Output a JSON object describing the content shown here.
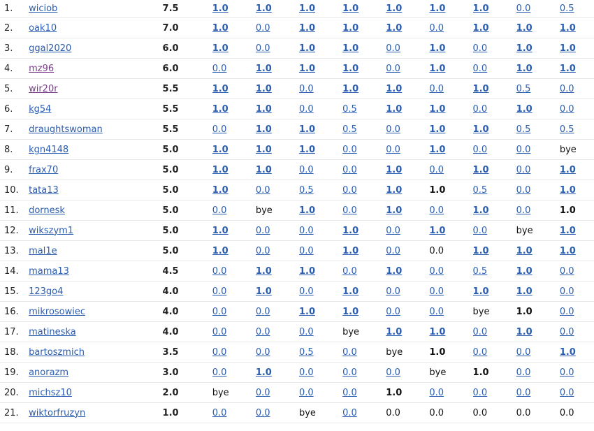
{
  "standings": [
    {
      "rank": "1.",
      "name": "wiciob",
      "points": "7.5",
      "visited": false,
      "results": [
        {
          "v": "1.0",
          "link": true
        },
        {
          "v": "1.0",
          "link": true
        },
        {
          "v": "1.0",
          "link": true
        },
        {
          "v": "1.0",
          "link": true
        },
        {
          "v": "1.0",
          "link": true
        },
        {
          "v": "1.0",
          "link": true
        },
        {
          "v": "1.0",
          "link": true
        },
        {
          "v": "0.0",
          "link": true
        },
        {
          "v": "0.5",
          "link": true
        }
      ]
    },
    {
      "rank": "2.",
      "name": "oak10",
      "points": "7.0",
      "visited": false,
      "results": [
        {
          "v": "1.0",
          "link": true
        },
        {
          "v": "0.0",
          "link": true
        },
        {
          "v": "1.0",
          "link": true
        },
        {
          "v": "1.0",
          "link": true
        },
        {
          "v": "1.0",
          "link": true
        },
        {
          "v": "0.0",
          "link": true
        },
        {
          "v": "1.0",
          "link": true
        },
        {
          "v": "1.0",
          "link": true
        },
        {
          "v": "1.0",
          "link": true
        }
      ]
    },
    {
      "rank": "3.",
      "name": "ggal2020",
      "points": "6.0",
      "visited": false,
      "results": [
        {
          "v": "1.0",
          "link": true
        },
        {
          "v": "0.0",
          "link": true
        },
        {
          "v": "1.0",
          "link": true
        },
        {
          "v": "1.0",
          "link": true
        },
        {
          "v": "0.0",
          "link": true
        },
        {
          "v": "1.0",
          "link": true
        },
        {
          "v": "0.0",
          "link": true
        },
        {
          "v": "1.0",
          "link": true
        },
        {
          "v": "1.0",
          "link": true
        }
      ]
    },
    {
      "rank": "4.",
      "name": "mz96",
      "points": "6.0",
      "visited": true,
      "results": [
        {
          "v": "0.0",
          "link": true
        },
        {
          "v": "1.0",
          "link": true
        },
        {
          "v": "1.0",
          "link": true
        },
        {
          "v": "1.0",
          "link": true
        },
        {
          "v": "0.0",
          "link": true
        },
        {
          "v": "1.0",
          "link": true
        },
        {
          "v": "0.0",
          "link": true
        },
        {
          "v": "1.0",
          "link": true
        },
        {
          "v": "1.0",
          "link": true
        }
      ]
    },
    {
      "rank": "5.",
      "name": "wir20r",
      "points": "5.5",
      "visited": true,
      "results": [
        {
          "v": "1.0",
          "link": true
        },
        {
          "v": "1.0",
          "link": true
        },
        {
          "v": "0.0",
          "link": true
        },
        {
          "v": "1.0",
          "link": true
        },
        {
          "v": "1.0",
          "link": true
        },
        {
          "v": "0.0",
          "link": true
        },
        {
          "v": "1.0",
          "link": true
        },
        {
          "v": "0.5",
          "link": true
        },
        {
          "v": "0.0",
          "link": true
        }
      ]
    },
    {
      "rank": "6.",
      "name": "kg54",
      "points": "5.5",
      "visited": false,
      "results": [
        {
          "v": "1.0",
          "link": true
        },
        {
          "v": "1.0",
          "link": true
        },
        {
          "v": "0.0",
          "link": true
        },
        {
          "v": "0.5",
          "link": true
        },
        {
          "v": "1.0",
          "link": true
        },
        {
          "v": "1.0",
          "link": true
        },
        {
          "v": "0.0",
          "link": true
        },
        {
          "v": "1.0",
          "link": true
        },
        {
          "v": "0.0",
          "link": true
        }
      ]
    },
    {
      "rank": "7.",
      "name": "draughtswoman",
      "points": "5.5",
      "visited": false,
      "results": [
        {
          "v": "0.0",
          "link": true
        },
        {
          "v": "1.0",
          "link": true
        },
        {
          "v": "1.0",
          "link": true
        },
        {
          "v": "0.5",
          "link": true
        },
        {
          "v": "0.0",
          "link": true
        },
        {
          "v": "1.0",
          "link": true
        },
        {
          "v": "1.0",
          "link": true
        },
        {
          "v": "0.5",
          "link": true
        },
        {
          "v": "0.5",
          "link": true
        }
      ]
    },
    {
      "rank": "8.",
      "name": "kgn4148",
      "points": "5.0",
      "visited": false,
      "results": [
        {
          "v": "1.0",
          "link": true
        },
        {
          "v": "1.0",
          "link": true
        },
        {
          "v": "1.0",
          "link": true
        },
        {
          "v": "0.0",
          "link": true
        },
        {
          "v": "0.0",
          "link": true
        },
        {
          "v": "1.0",
          "link": true
        },
        {
          "v": "0.0",
          "link": true
        },
        {
          "v": "0.0",
          "link": true
        },
        {
          "v": "bye",
          "link": false
        }
      ]
    },
    {
      "rank": "9.",
      "name": "frax70",
      "points": "5.0",
      "visited": false,
      "results": [
        {
          "v": "1.0",
          "link": true
        },
        {
          "v": "1.0",
          "link": true
        },
        {
          "v": "0.0",
          "link": true
        },
        {
          "v": "0.0",
          "link": true
        },
        {
          "v": "1.0",
          "link": true
        },
        {
          "v": "0.0",
          "link": true
        },
        {
          "v": "1.0",
          "link": true
        },
        {
          "v": "0.0",
          "link": true
        },
        {
          "v": "1.0",
          "link": true
        }
      ]
    },
    {
      "rank": "10.",
      "name": "tata13",
      "points": "5.0",
      "visited": false,
      "results": [
        {
          "v": "1.0",
          "link": true
        },
        {
          "v": "0.0",
          "link": true
        },
        {
          "v": "0.5",
          "link": true
        },
        {
          "v": "0.0",
          "link": true
        },
        {
          "v": "1.0",
          "link": true
        },
        {
          "v": "1.0",
          "link": false
        },
        {
          "v": "0.5",
          "link": true
        },
        {
          "v": "0.0",
          "link": true
        },
        {
          "v": "1.0",
          "link": true
        }
      ]
    },
    {
      "rank": "11.",
      "name": "dornesk",
      "points": "5.0",
      "visited": false,
      "results": [
        {
          "v": "0.0",
          "link": true
        },
        {
          "v": "bye",
          "link": false
        },
        {
          "v": "1.0",
          "link": true
        },
        {
          "v": "0.0",
          "link": true
        },
        {
          "v": "1.0",
          "link": true
        },
        {
          "v": "0.0",
          "link": true
        },
        {
          "v": "1.0",
          "link": true
        },
        {
          "v": "0.0",
          "link": true
        },
        {
          "v": "1.0",
          "link": false
        }
      ]
    },
    {
      "rank": "12.",
      "name": "wikszym1",
      "points": "5.0",
      "visited": false,
      "results": [
        {
          "v": "1.0",
          "link": true
        },
        {
          "v": "0.0",
          "link": true
        },
        {
          "v": "0.0",
          "link": true
        },
        {
          "v": "1.0",
          "link": true
        },
        {
          "v": "0.0",
          "link": true
        },
        {
          "v": "1.0",
          "link": true
        },
        {
          "v": "0.0",
          "link": true
        },
        {
          "v": "bye",
          "link": false
        },
        {
          "v": "1.0",
          "link": true
        }
      ]
    },
    {
      "rank": "13.",
      "name": "mal1e",
      "points": "5.0",
      "visited": false,
      "results": [
        {
          "v": "1.0",
          "link": true
        },
        {
          "v": "0.0",
          "link": true
        },
        {
          "v": "0.0",
          "link": true
        },
        {
          "v": "1.0",
          "link": true
        },
        {
          "v": "0.0",
          "link": true
        },
        {
          "v": "0.0",
          "link": false
        },
        {
          "v": "1.0",
          "link": true
        },
        {
          "v": "1.0",
          "link": true
        },
        {
          "v": "1.0",
          "link": true
        }
      ]
    },
    {
      "rank": "14.",
      "name": "mama13",
      "points": "4.5",
      "visited": false,
      "results": [
        {
          "v": "0.0",
          "link": true
        },
        {
          "v": "1.0",
          "link": true
        },
        {
          "v": "1.0",
          "link": true
        },
        {
          "v": "0.0",
          "link": true
        },
        {
          "v": "1.0",
          "link": true
        },
        {
          "v": "0.0",
          "link": true
        },
        {
          "v": "0.5",
          "link": true
        },
        {
          "v": "1.0",
          "link": true
        },
        {
          "v": "0.0",
          "link": true
        }
      ]
    },
    {
      "rank": "15.",
      "name": "123go4",
      "points": "4.0",
      "visited": false,
      "results": [
        {
          "v": "0.0",
          "link": true
        },
        {
          "v": "1.0",
          "link": true
        },
        {
          "v": "0.0",
          "link": true
        },
        {
          "v": "1.0",
          "link": true
        },
        {
          "v": "0.0",
          "link": true
        },
        {
          "v": "0.0",
          "link": true
        },
        {
          "v": "1.0",
          "link": true
        },
        {
          "v": "1.0",
          "link": true
        },
        {
          "v": "0.0",
          "link": true
        }
      ]
    },
    {
      "rank": "16.",
      "name": "mikrosowiec",
      "points": "4.0",
      "visited": false,
      "results": [
        {
          "v": "0.0",
          "link": true
        },
        {
          "v": "0.0",
          "link": true
        },
        {
          "v": "1.0",
          "link": true
        },
        {
          "v": "1.0",
          "link": true
        },
        {
          "v": "0.0",
          "link": true
        },
        {
          "v": "0.0",
          "link": true
        },
        {
          "v": "bye",
          "link": false
        },
        {
          "v": "1.0",
          "link": false
        },
        {
          "v": "0.0",
          "link": true
        }
      ]
    },
    {
      "rank": "17.",
      "name": "matineska",
      "points": "4.0",
      "visited": false,
      "results": [
        {
          "v": "0.0",
          "link": true
        },
        {
          "v": "0.0",
          "link": true
        },
        {
          "v": "0.0",
          "link": true
        },
        {
          "v": "bye",
          "link": false
        },
        {
          "v": "1.0",
          "link": true
        },
        {
          "v": "1.0",
          "link": true
        },
        {
          "v": "0.0",
          "link": true
        },
        {
          "v": "1.0",
          "link": true
        },
        {
          "v": "0.0",
          "link": true
        }
      ]
    },
    {
      "rank": "18.",
      "name": "bartoszmich",
      "points": "3.5",
      "visited": false,
      "results": [
        {
          "v": "0.0",
          "link": true
        },
        {
          "v": "0.0",
          "link": true
        },
        {
          "v": "0.5",
          "link": true
        },
        {
          "v": "0.0",
          "link": true
        },
        {
          "v": "bye",
          "link": false
        },
        {
          "v": "1.0",
          "link": false
        },
        {
          "v": "0.0",
          "link": true
        },
        {
          "v": "0.0",
          "link": true
        },
        {
          "v": "1.0",
          "link": true
        }
      ]
    },
    {
      "rank": "19.",
      "name": "anorazm",
      "points": "3.0",
      "visited": false,
      "results": [
        {
          "v": "0.0",
          "link": true
        },
        {
          "v": "1.0",
          "link": true
        },
        {
          "v": "0.0",
          "link": true
        },
        {
          "v": "0.0",
          "link": true
        },
        {
          "v": "0.0",
          "link": true
        },
        {
          "v": "bye",
          "link": false
        },
        {
          "v": "1.0",
          "link": false
        },
        {
          "v": "0.0",
          "link": true
        },
        {
          "v": "0.0",
          "link": true
        }
      ]
    },
    {
      "rank": "20.",
      "name": "michsz10",
      "points": "2.0",
      "visited": false,
      "results": [
        {
          "v": "bye",
          "link": false
        },
        {
          "v": "0.0",
          "link": true
        },
        {
          "v": "0.0",
          "link": true
        },
        {
          "v": "0.0",
          "link": true
        },
        {
          "v": "1.0",
          "link": false
        },
        {
          "v": "0.0",
          "link": true
        },
        {
          "v": "0.0",
          "link": true
        },
        {
          "v": "0.0",
          "link": true
        },
        {
          "v": "0.0",
          "link": true
        }
      ]
    },
    {
      "rank": "21.",
      "name": "wiktorfruzyn",
      "points": "1.0",
      "visited": false,
      "results": [
        {
          "v": "0.0",
          "link": true
        },
        {
          "v": "0.0",
          "link": true
        },
        {
          "v": "bye",
          "link": false
        },
        {
          "v": "0.0",
          "link": true
        },
        {
          "v": "0.0",
          "link": false
        },
        {
          "v": "0.0",
          "link": false
        },
        {
          "v": "0.0",
          "link": false
        },
        {
          "v": "0.0",
          "link": false
        },
        {
          "v": "0.0",
          "link": false
        }
      ]
    }
  ],
  "colors": {
    "link": "#2a5db0",
    "visited_link": "#7a3a8a",
    "row_border": "#e6e6e6",
    "text": "#222222"
  }
}
